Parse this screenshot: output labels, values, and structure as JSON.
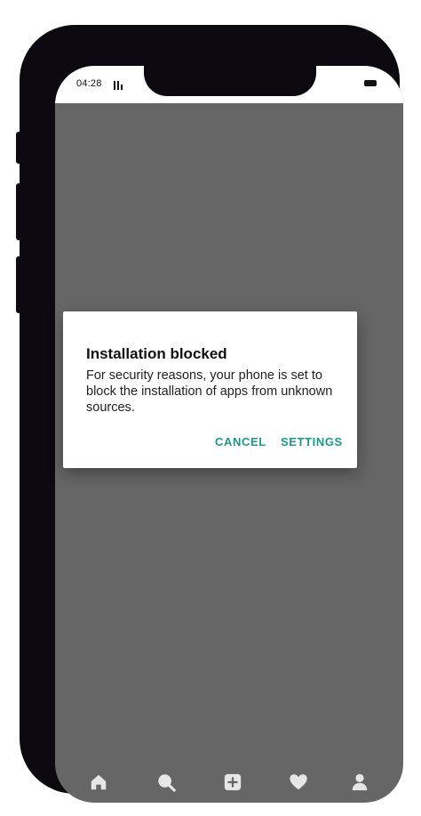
{
  "status": {
    "time": "04:28"
  },
  "dialog": {
    "title": "Installation blocked",
    "message": "For security reasons, your phone is set to block the installation of apps from unknown sources.",
    "cancel_label": "CANCEL",
    "settings_label": "SETTINGS"
  },
  "bottom_nav": {
    "icons": [
      "home-icon",
      "search-icon",
      "add-icon",
      "heart-icon",
      "profile-icon"
    ]
  },
  "colors": {
    "accent": "#1a9a8a",
    "overlay": "#666666",
    "frame": "#0c0a10",
    "nav_icon": "#e6e6e6"
  }
}
